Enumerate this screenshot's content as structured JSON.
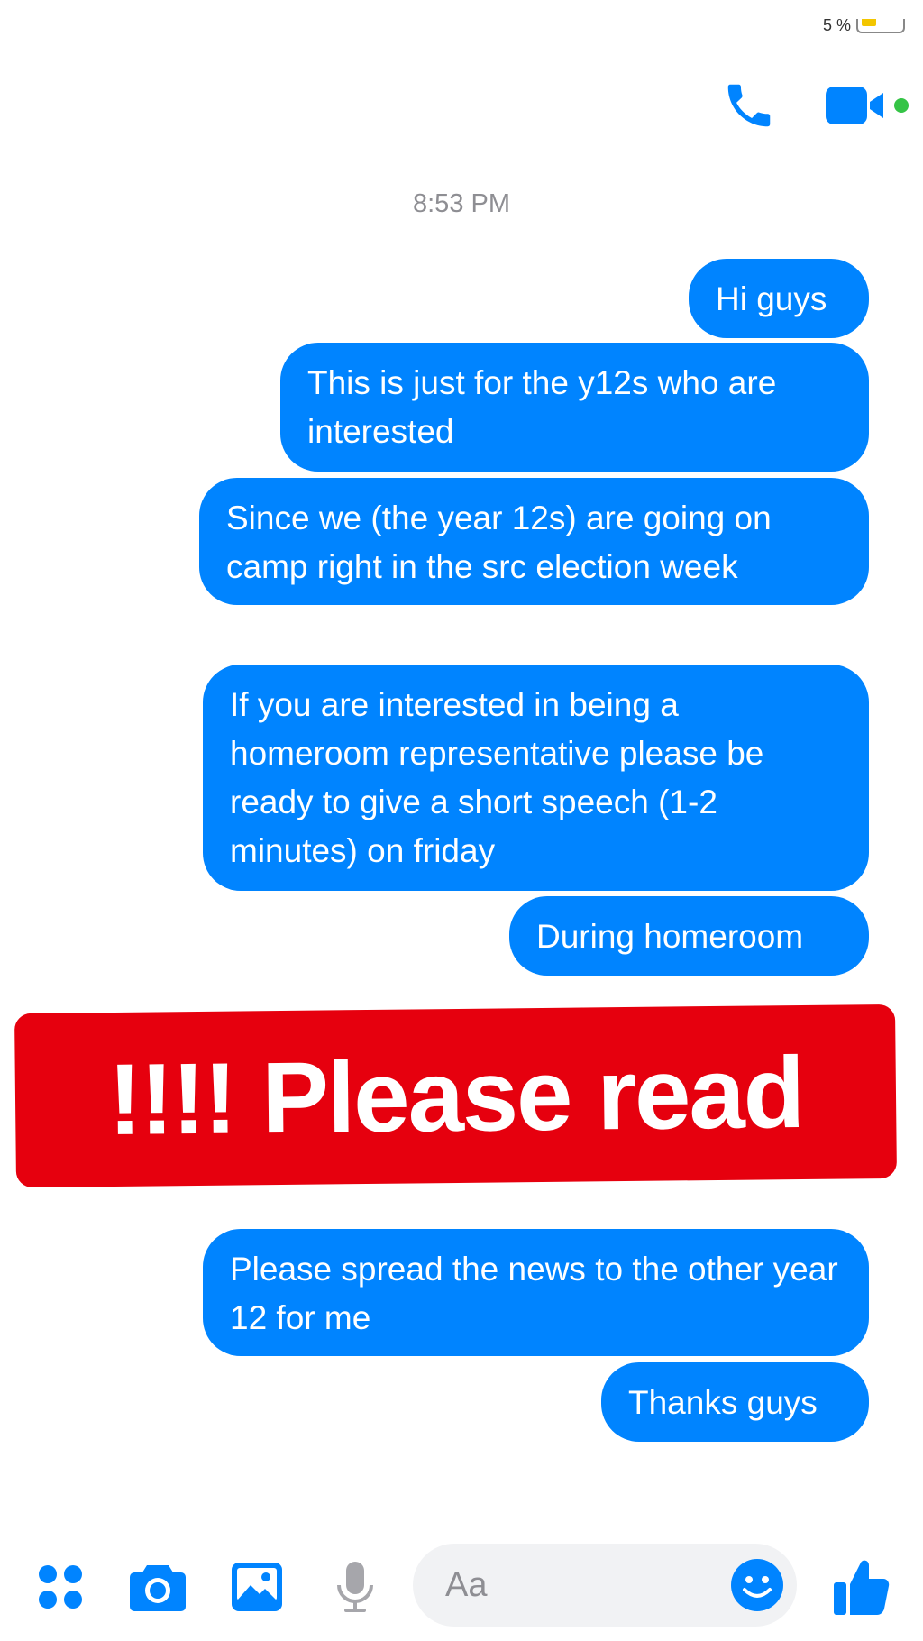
{
  "status": {
    "battery_text": "5 %"
  },
  "header": {
    "call_icon": "phone-icon",
    "video_icon": "video-camera-icon",
    "online_color": "#35c446"
  },
  "thread": {
    "timestamp": "8:53 PM",
    "bubble_color": "#0084ff",
    "messages": [
      {
        "text": "Hi guys"
      },
      {
        "text": "This is just for the y12s who are interested"
      },
      {
        "text": "Since we (the year 12s) are going on camp right in the src election week"
      },
      {
        "text": "If you are interested in being a homeroom representative please be ready to give a short speech (1-2 minutes) on friday"
      },
      {
        "text": "During homeroom"
      },
      {
        "text": "Please spread the news to the other year 12 for me"
      },
      {
        "text": "Thanks guys"
      }
    ]
  },
  "banner": {
    "text": "!!!! Please read",
    "color": "#e6000e"
  },
  "composer": {
    "placeholder": "Aa",
    "icons": [
      "apps-icon",
      "camera-icon",
      "gallery-icon",
      "microphone-icon",
      "emoji-icon",
      "thumbs-up-icon"
    ]
  }
}
